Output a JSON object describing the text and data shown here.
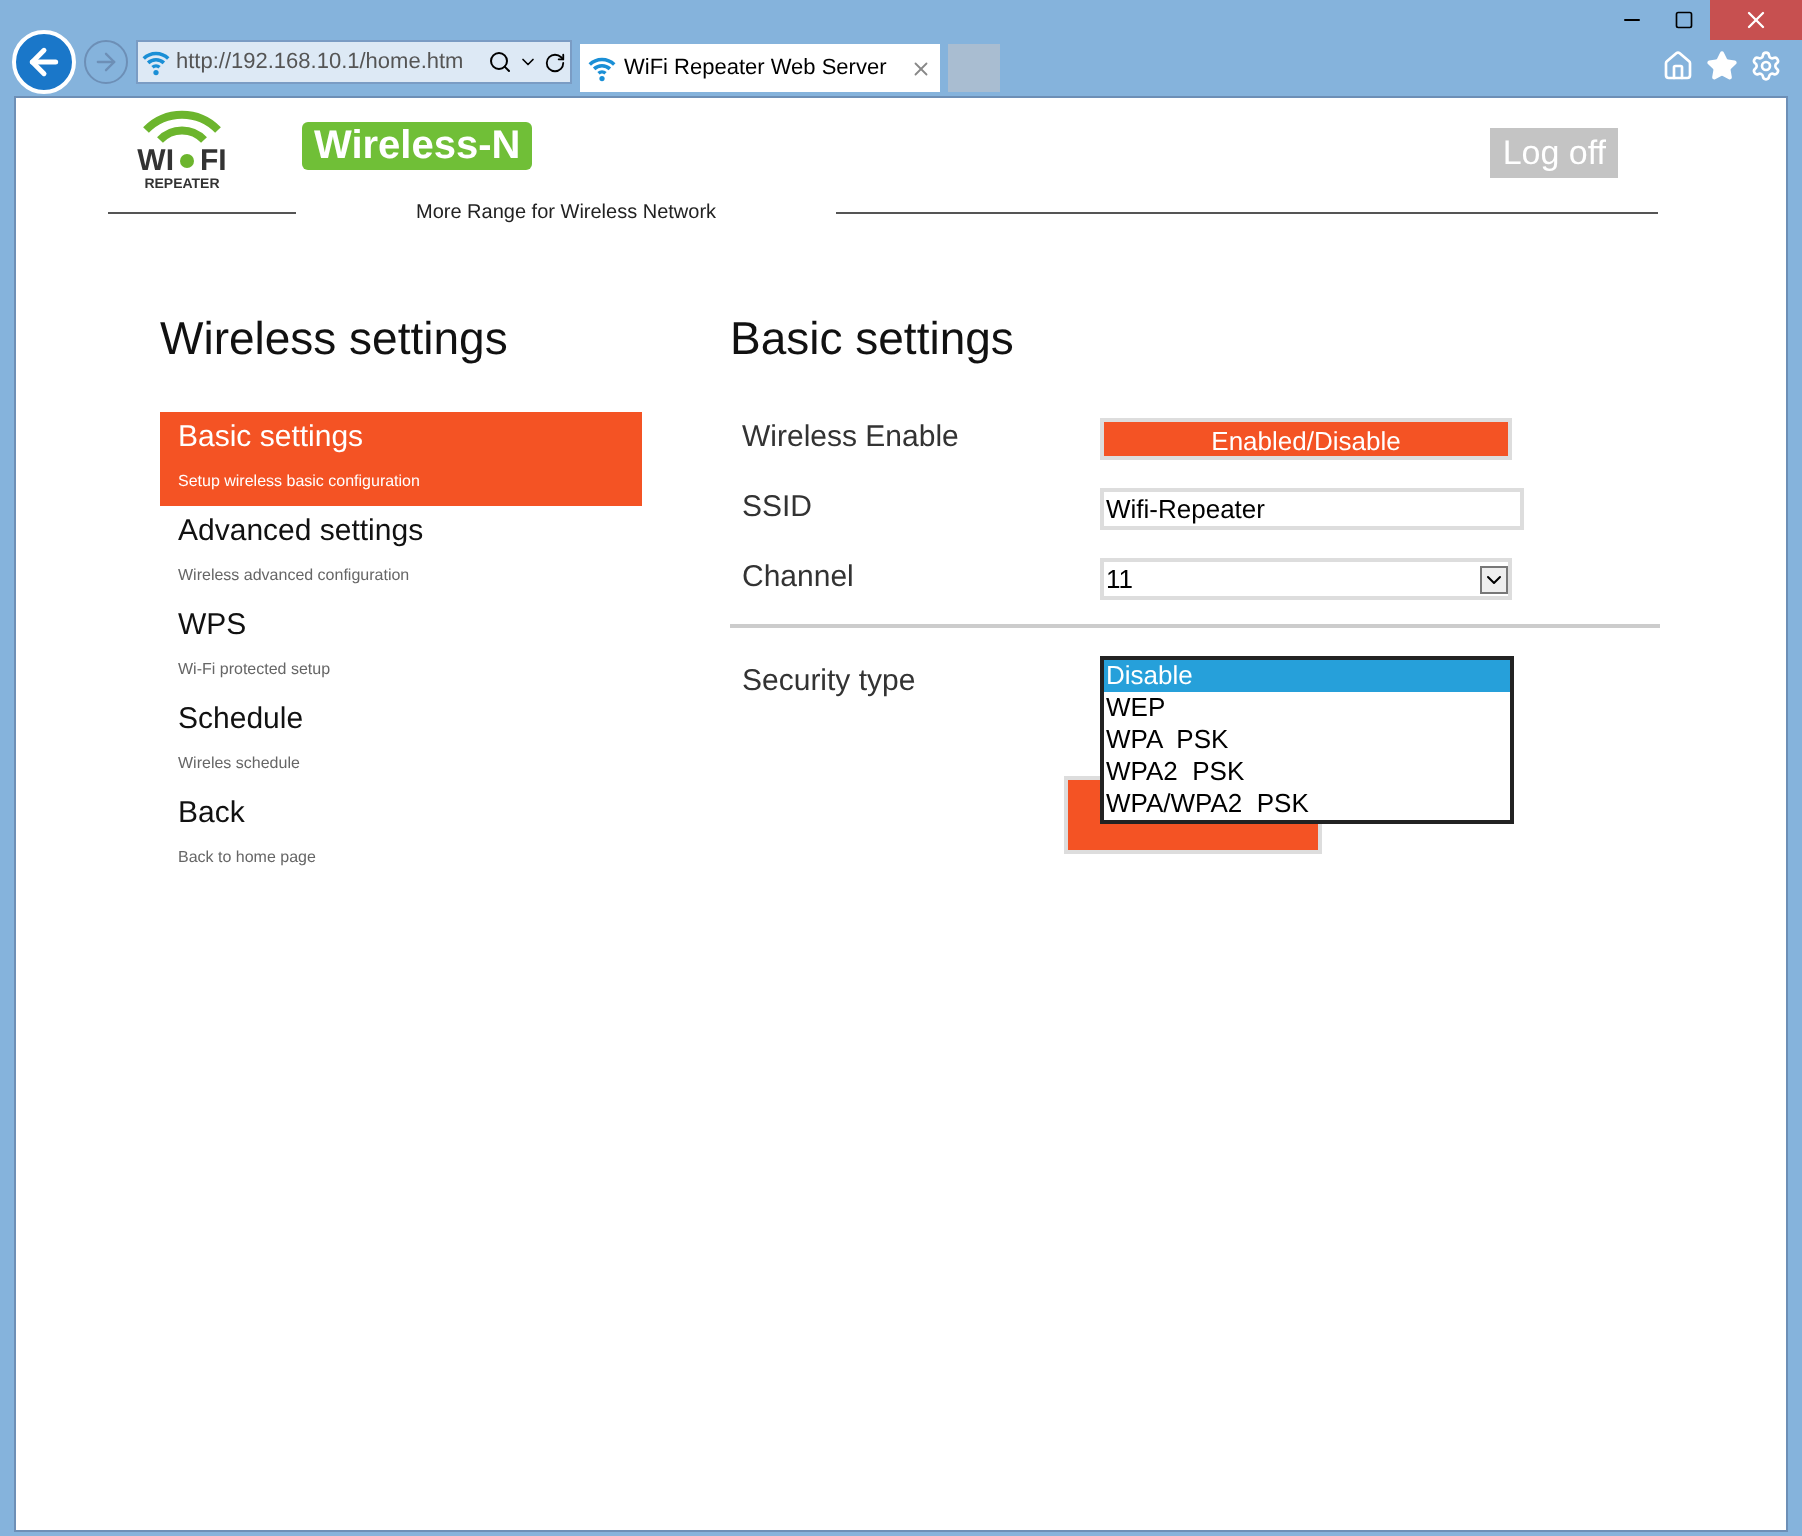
{
  "browser": {
    "address": "http://192.168.10.1/home.htm",
    "tab_title": "WiFi Repeater Web Server"
  },
  "header": {
    "logo_text": "WI",
    "logo_text_2": "FI",
    "logo_sub": "REPEATER",
    "badge": "Wireless-N",
    "tagline": "More Range for Wireless Network",
    "logoff": "Log off"
  },
  "sidebar": {
    "title": "Wireless settings",
    "items": [
      {
        "label": "Basic settings",
        "description": "Setup wireless basic configuration",
        "selected": true
      },
      {
        "label": "Advanced settings",
        "description": "Wireless advanced configuration",
        "selected": false
      },
      {
        "label": "WPS",
        "description": "Wi-Fi protected setup",
        "selected": false
      },
      {
        "label": "Schedule",
        "description": "Wireles schedule",
        "selected": false
      },
      {
        "label": "Back",
        "description": "Back to home page",
        "selected": false
      }
    ]
  },
  "main": {
    "title": "Basic settings",
    "fields": [
      {
        "kind": "button",
        "label": "Wireless Enable",
        "value": "Enabled/Disable"
      },
      {
        "kind": "text",
        "label": "SSID",
        "value": "Wifi-Repeater"
      },
      {
        "kind": "select",
        "label": "Channel",
        "value": "11"
      }
    ],
    "security": {
      "label": "Security type",
      "options": [
        {
          "label": "Disable",
          "selected": true
        },
        {
          "label": "WEP",
          "selected": false
        },
        {
          "label": "WPA  PSK",
          "selected": false
        },
        {
          "label": "WPA2  PSK",
          "selected": false
        },
        {
          "label": "WPA/WPA2  PSK",
          "selected": false
        }
      ]
    }
  }
}
